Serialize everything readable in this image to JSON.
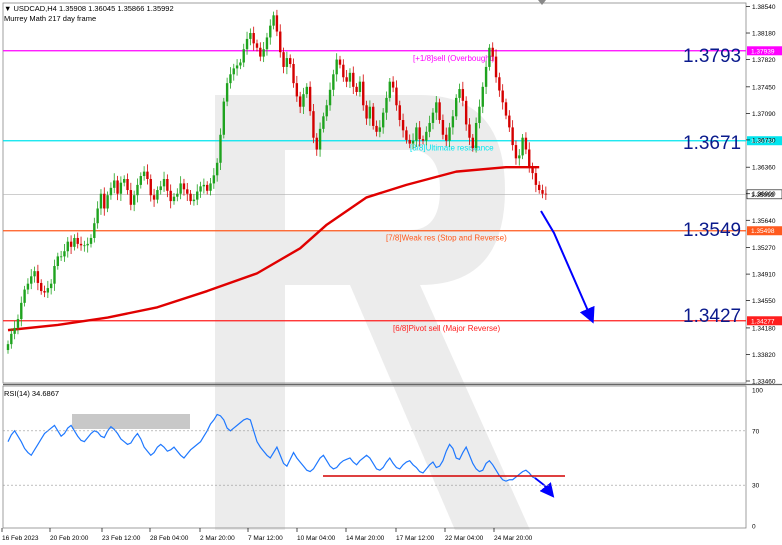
{
  "header": {
    "symbol_line": "USDCAD,H4  1.35908 1.36045 1.35866 1.35992",
    "indicator_line": "Murrey Math 217 day frame"
  },
  "rsi_header": "RSI(14) 34.6867",
  "big_levels": [
    "1.3793",
    "1.3671",
    "1.3549",
    "1.3427"
  ],
  "colors": {
    "bull": "#1fa31f",
    "bear": "#d40000",
    "ma": "#e00000",
    "rsi_line": "#1e78ff",
    "level_magenta": "#ff00ff",
    "level_cyan": "#00e5ee",
    "level_orange": "#ff5a1e",
    "level_red": "#ff1e1e",
    "arrow": "#0000ff",
    "watermark": "#dcdcdc"
  },
  "chart_data": [
    {
      "type": "candlestick",
      "symbol": "USDCAD",
      "timeframe": "H4",
      "ylim": [
        1.3346,
        1.3856
      ],
      "y_ticks": [
        "1.38540",
        "1.38180",
        "1.37820",
        "1.37450",
        "1.37090",
        "1.36730",
        "1.36360",
        "1.36000",
        "1.35640",
        "1.35270",
        "1.34910",
        "1.34550",
        "1.34180",
        "1.33820",
        "1.33460"
      ],
      "x_ticks": [
        "16 Feb 2023",
        "20 Feb 20:00",
        "23 Feb 12:00",
        "28 Feb 04:00",
        "2 Mar 20:00",
        "7 Mar 12:00",
        "10 Mar 04:00",
        "14 Mar 20:00",
        "17 Mar 12:00",
        "22 Mar 04:00",
        "24 Mar 20:00"
      ],
      "current_price": "1.35992",
      "moving_average": {
        "name": "",
        "points": [
          [
            0,
            1.3415
          ],
          [
            15,
            1.3422
          ],
          [
            30,
            1.3432
          ],
          [
            45,
            1.3446
          ],
          [
            60,
            1.3468
          ],
          [
            75,
            1.3492
          ],
          [
            88,
            1.3526
          ],
          [
            96,
            1.3558
          ],
          [
            108,
            1.3595
          ],
          [
            120,
            1.3612
          ],
          [
            135,
            1.363
          ],
          [
            150,
            1.3636
          ],
          [
            160,
            1.3636
          ]
        ]
      },
      "levels": [
        {
          "value": 1.37939,
          "tag": "1.37939",
          "label": "[+1/8]sell (Overbought)"
        },
        {
          "value": 1.36719,
          "tag": "1.36719",
          "label": "[8/8]Ultimate resistance"
        },
        {
          "value": 1.35498,
          "tag": "1.35498",
          "label": "[7/8]Weak res (Stop and Reverse)"
        },
        {
          "value": 1.34277,
          "tag": "1.34277",
          "label": "[6/8]Pivot sell (Major Reverse)"
        }
      ],
      "closes": [
        1.3396,
        1.341,
        1.3418,
        1.343,
        1.3452,
        1.347,
        1.3478,
        1.3488,
        1.3495,
        1.3479,
        1.3468,
        1.3466,
        1.3472,
        1.3478,
        1.3502,
        1.3515,
        1.3515,
        1.3522,
        1.3535,
        1.3528,
        1.354,
        1.3532,
        1.353,
        1.353,
        1.3532,
        1.354,
        1.356,
        1.358,
        1.36,
        1.358,
        1.3598,
        1.3608,
        1.3618,
        1.36,
        1.3615,
        1.362,
        1.3605,
        1.3585,
        1.3598,
        1.3612,
        1.3624,
        1.363,
        1.362,
        1.3598,
        1.3592,
        1.3605,
        1.361,
        1.362,
        1.3604,
        1.359,
        1.3596,
        1.36,
        1.3614,
        1.3606,
        1.36,
        1.359,
        1.3592,
        1.3603,
        1.361,
        1.3612,
        1.3604,
        1.3614,
        1.3625,
        1.3642,
        1.368,
        1.3725,
        1.375,
        1.3762,
        1.377,
        1.3774,
        1.3778,
        1.3796,
        1.381,
        1.3818,
        1.3804,
        1.3798,
        1.3786,
        1.3796,
        1.3812,
        1.3828,
        1.3842,
        1.382,
        1.3792,
        1.3772,
        1.3784,
        1.3776,
        1.375,
        1.3732,
        1.3718,
        1.3735,
        1.3745,
        1.3712,
        1.3676,
        1.366,
        1.3688,
        1.3705,
        1.372,
        1.3741,
        1.3762,
        1.3782,
        1.3775,
        1.3758,
        1.3752,
        1.3764,
        1.3745,
        1.3738,
        1.3752,
        1.372,
        1.3702,
        1.3718,
        1.3692,
        1.3684,
        1.369,
        1.371,
        1.373,
        1.3752,
        1.3744,
        1.372,
        1.37,
        1.3686,
        1.3673,
        1.3668,
        1.3672,
        1.369,
        1.3674,
        1.3672,
        1.3684,
        1.3696,
        1.371,
        1.3724,
        1.37,
        1.368,
        1.3672,
        1.369,
        1.3705,
        1.373,
        1.3742,
        1.3726,
        1.3694,
        1.3676,
        1.3662,
        1.3696,
        1.3718,
        1.3745,
        1.3772,
        1.3798,
        1.3786,
        1.3758,
        1.374,
        1.3724,
        1.3706,
        1.369,
        1.3666,
        1.3648,
        1.3652,
        1.3676,
        1.366,
        1.3636,
        1.3628,
        1.3612,
        1.3605,
        1.36,
        1.3599
      ]
    },
    {
      "type": "line",
      "name": "RSI(14)",
      "ylim": [
        0,
        100
      ],
      "y_ticks": [
        "100",
        "70",
        "30",
        "0"
      ],
      "values": [
        62,
        67,
        70,
        66,
        62,
        57,
        54,
        52,
        56,
        60,
        64,
        68,
        70,
        72,
        74,
        70,
        66,
        68,
        72,
        74,
        70,
        66,
        63,
        62,
        65,
        68,
        70,
        69,
        66,
        65,
        70,
        73,
        71,
        68,
        64,
        62,
        60,
        61,
        65,
        68,
        64,
        58,
        55,
        52,
        54,
        58,
        60,
        58,
        55,
        56,
        58,
        55,
        52,
        50,
        53,
        56,
        58,
        60,
        62,
        66,
        70,
        75,
        78,
        82,
        81,
        78,
        72,
        70,
        72,
        74,
        76,
        78,
        79,
        78,
        70,
        62,
        58,
        55,
        52,
        50,
        54,
        58,
        52,
        46,
        44,
        49,
        54,
        50,
        47,
        44,
        41,
        40,
        42,
        46,
        50,
        52,
        48,
        44,
        42,
        43,
        46,
        48,
        49,
        50,
        47,
        45,
        48,
        50,
        52,
        50,
        46,
        42,
        41,
        43,
        47,
        50,
        46,
        43,
        42,
        45,
        47,
        48,
        45,
        43,
        40,
        39,
        42,
        45,
        47,
        43,
        44,
        48,
        55,
        60,
        57,
        50,
        49,
        54,
        58,
        52,
        46,
        42,
        40,
        41,
        46,
        48,
        45,
        41,
        37,
        34,
        33,
        34,
        34,
        36,
        38,
        40,
        41,
        39,
        36,
        35
      ],
      "overbought_band": [
        70,
        80
      ]
    }
  ]
}
